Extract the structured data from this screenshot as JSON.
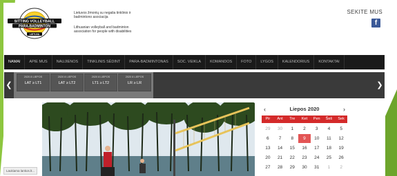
{
  "header": {
    "association_lt": "Lietuvos žmonių su negalia tinklinio ir badmintono asociacija",
    "association_en": "Lithuanian volleyball and badminton association for people with disabilities",
    "logo": {
      "line1": "SITTING VOLLEYBALL",
      "line2": "PARA-BADMINTON",
      "line3": "LIETUVA"
    },
    "follow_label": "SEKITE MUS",
    "facebook_icon": "f"
  },
  "nav": {
    "items": [
      "NAMAI",
      "APIE MUS",
      "NAUJIENOS",
      "TINKLINIS SĖDINT",
      "PARA-BADMINTONAS",
      "SOC. VEIKLA",
      "KOMANDOS",
      "FOTO",
      "LYGOS",
      "KALENDORIUS",
      "KONTAKTAI"
    ],
    "active": "NAMAI"
  },
  "results": {
    "prev_arrow": "❮",
    "next_arrow": "❯",
    "matches": [
      {
        "date": "2020 8 LIEPOS",
        "teams": "LAT ≥ LT1"
      },
      {
        "date": "2020 8 LIEPOS",
        "teams": "LAT ≥ LT2"
      },
      {
        "date": "2020 8 LIEPOS",
        "teams": "LT1 ≥ LT2"
      },
      {
        "date": "2020 8 LIEPOS",
        "teams": "LR ≥ LR"
      }
    ]
  },
  "status_bar": "Laukiama lankos.lt...",
  "calendar": {
    "title": "Liepos 2020",
    "prev": "‹",
    "next": "›",
    "weekdays": [
      "Pir",
      "Ant",
      "Tre",
      "Ket",
      "Pen",
      "Šeš",
      "Sek"
    ],
    "today": "9",
    "weeks": [
      [
        "29",
        "30",
        "1",
        "2",
        "3",
        "4",
        "5"
      ],
      [
        "6",
        "7",
        "8",
        "9",
        "10",
        "11",
        "12"
      ],
      [
        "13",
        "14",
        "15",
        "16",
        "17",
        "18",
        "19"
      ],
      [
        "20",
        "21",
        "22",
        "23",
        "24",
        "25",
        "26"
      ],
      [
        "27",
        "28",
        "29",
        "30",
        "31",
        "1",
        "2"
      ]
    ],
    "other_month": [
      [
        0,
        0
      ],
      [
        0,
        1
      ],
      [
        4,
        5
      ],
      [
        4,
        6
      ]
    ]
  },
  "colors": {
    "nav_bg": "#1a1a1a",
    "calendar_accent": "#d42a2a",
    "today_bg": "#e35555",
    "facebook": "#3b5998",
    "green": "#8dc63f"
  }
}
